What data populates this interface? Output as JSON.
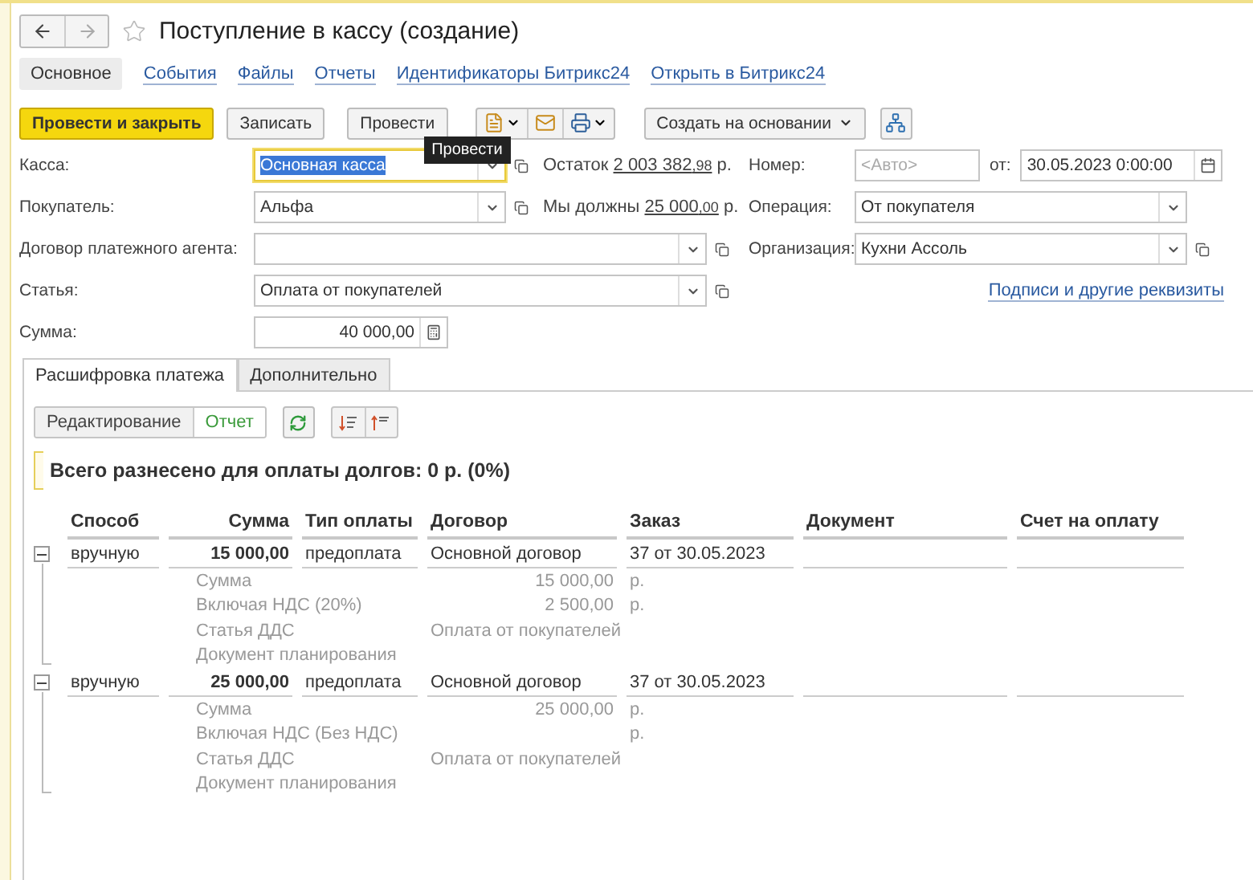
{
  "window": {
    "title": "Поступление в кассу (создание)",
    "favorite": false
  },
  "nav": [
    {
      "kind": "back",
      "disabled": false
    },
    {
      "kind": "forward",
      "disabled": true
    }
  ],
  "sections": [
    {
      "label": "Основное",
      "selected": true
    },
    {
      "label": "События",
      "selected": false
    },
    {
      "label": "Файлы",
      "selected": false
    },
    {
      "label": "Отчеты",
      "selected": false
    },
    {
      "label": "Идентификаторы Битрикс24",
      "selected": false
    },
    {
      "label": "Открыть в Битрикс24",
      "selected": false
    }
  ],
  "toolbar": [
    {
      "kind": "primary",
      "label": "Провести и закрыть"
    },
    {
      "kind": "button",
      "label": "Записать"
    },
    {
      "kind": "button",
      "label": "Провести",
      "tooltip": "Провести"
    },
    {
      "kind": "icons",
      "icons": [
        {
          "kind": "document",
          "menu": true
        },
        {
          "kind": "mail",
          "menu": false
        },
        {
          "kind": "print",
          "menu": true
        }
      ]
    },
    {
      "kind": "menu",
      "label": "Создать на основании"
    },
    {
      "kind": "icon"
    }
  ],
  "form": {
    "rows": [
      {
        "label": "Касса:",
        "field": {
          "kind": "select-open",
          "value": "Основная касса",
          "focused": true
        },
        "info": {
          "label": "Остаток",
          "amount": "2 003 382",
          "cents": ",98",
          "unit": "р."
        },
        "right": {
          "label": "Номер:",
          "field": {
            "kind": "text",
            "placeholder": "<Авто>",
            "focused": false
          },
          "extra_label": "от:",
          "extra_field": {
            "kind": "date",
            "value": "30.05.2023  0:00:00",
            "focused": false
          }
        }
      },
      {
        "label": "Покупатель:",
        "field": {
          "kind": "select-open",
          "value": "Альфа",
          "focused": false
        },
        "info": {
          "label": "Мы должны",
          "amount": "25 000",
          "cents": ",00",
          "unit": "р."
        },
        "right": {
          "label": "Операция:",
          "field": {
            "kind": "select",
            "value": "От покупателя",
            "focused": false
          }
        }
      },
      {
        "label": "Договор платежного агента:",
        "field": {
          "kind": "select-open",
          "focused": false
        },
        "right": {
          "label": "Организация:",
          "field": {
            "kind": "select-open",
            "value": "Кухни Ассоль",
            "focused": false
          }
        }
      },
      {
        "label": "Статья:",
        "field": {
          "kind": "select-open",
          "value": "Оплата от покупателей",
          "focused": false
        },
        "right": {
          "link": "Подписи и другие реквизиты"
        }
      },
      {
        "label": "Сумма:",
        "field": {
          "kind": "number",
          "value": "40 000,00",
          "focused": false
        }
      }
    ]
  },
  "tabs": [
    {
      "label": "Расшифровка платежа",
      "selected": true
    },
    {
      "label": "Дополнительно",
      "selected": false
    }
  ],
  "mode": [
    {
      "label": "Редактирование",
      "selected": false
    },
    {
      "label": "Отчет",
      "selected": true
    }
  ],
  "summary": "Всего разнесено для оплаты долгов: 0 р. (0%)",
  "table": {
    "columns": [
      "Способ",
      "Сумма",
      "Тип оплаты",
      "Договор",
      "Заказ",
      "Документ",
      "Счет на оплату"
    ],
    "rows": [
      {
        "expanded": true,
        "cells": [
          "вручную",
          "15 000,00",
          "предоплата",
          "Основной договор",
          "37 от 30.05.2023",
          "",
          ""
        ],
        "details": [
          {
            "kind": "amount",
            "label": "Сумма",
            "value": "15 000,00",
            "unit": "р."
          },
          {
            "kind": "amount",
            "label": "Включая НДС (20%)",
            "value": "2 500,00",
            "unit": "р."
          },
          {
            "kind": "text",
            "label": "Статья ДДС",
            "value": "Оплата от покупателей"
          },
          {
            "kind": "text",
            "label": "Документ планирования"
          }
        ]
      },
      {
        "expanded": true,
        "cells": [
          "вручную",
          "25 000,00",
          "предоплата",
          "Основной договор",
          "37 от 30.05.2023",
          "",
          ""
        ],
        "details": [
          {
            "kind": "amount",
            "label": "Сумма",
            "value": "25 000,00",
            "unit": "р."
          },
          {
            "kind": "amount",
            "label": "Включая НДС (Без НДС)",
            "unit": "р."
          },
          {
            "kind": "text",
            "label": "Статья ДДС",
            "value": "Оплата от покупателей"
          },
          {
            "kind": "text",
            "label": "Документ планирования"
          }
        ]
      }
    ]
  }
}
